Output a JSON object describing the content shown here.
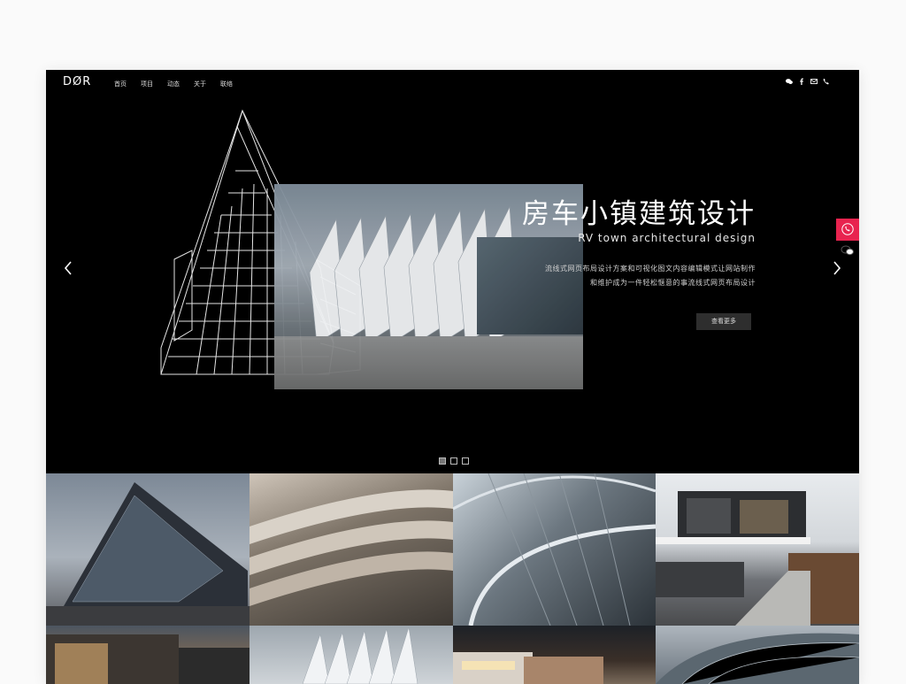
{
  "brand": {
    "logo": "DØR"
  },
  "nav": {
    "items": [
      "首页",
      "项目",
      "动态",
      "关于",
      "联络"
    ]
  },
  "social": {
    "icons": [
      "wechat-icon",
      "facebook-icon",
      "mail-icon",
      "phone-icon"
    ]
  },
  "hero": {
    "title": "房车小镇建筑设计",
    "subtitle": "RV town architectural design",
    "desc_line1": "流线式网页布局设计方案和可视化图文内容编辑模式让网站制作",
    "desc_line2": "和维护成为一件轻松惬意的事流线式网页布局设计",
    "button": "查看更多",
    "slides": 3,
    "active_slide": 1
  },
  "side": {
    "phone_icon": "phone-icon",
    "chat_icon": "wechat-icon",
    "accent": "#e8234f"
  },
  "gallery": {
    "tiles": 8
  }
}
